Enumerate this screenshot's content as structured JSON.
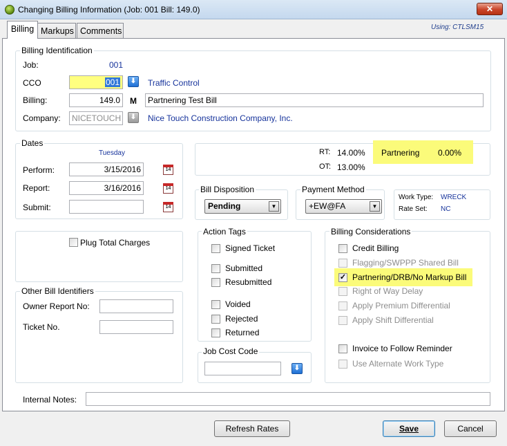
{
  "window": {
    "title": "Changing Billing Information  (Job: 001  Bill: 149.0)",
    "close": "✕"
  },
  "tabs": [
    "Billing",
    "Markups",
    "Comments"
  ],
  "using": "Using:  CTLSM15",
  "billing_id": {
    "legend": "Billing Identification",
    "job_label": "Job:",
    "job_value": "001",
    "cco_label": "CCO",
    "cco_value": "001",
    "cco_desc": "Traffic Control",
    "billing_label": "Billing:",
    "billing_value": "149.0",
    "billing_flag": "M",
    "billing_desc": "Partnering Test Bill",
    "company_label": "Company:",
    "company_value": "NICETOUCH",
    "company_desc": "Nice Touch Construction Company, Inc."
  },
  "dates": {
    "legend": "Dates",
    "weekday": "Tuesday",
    "perform_label": "Perform:",
    "perform_value": "3/15/2016",
    "report_label": "Report:",
    "report_value": "3/16/2016",
    "submit_label": "Submit:",
    "submit_value": "",
    "cal_text": "14"
  },
  "rates": {
    "rt_label": "RT:",
    "rt_value": "14.00%",
    "ot_label": "OT:",
    "ot_value": "13.00%",
    "partnering_label": "Partnering",
    "partnering_value": "0.00%"
  },
  "bill_disposition": {
    "legend": "Bill Disposition",
    "value": "Pending"
  },
  "payment_method": {
    "legend": "Payment Method",
    "value": "+EW@FA"
  },
  "work": {
    "type_label": "Work Type:",
    "type_value": "WRECK",
    "rate_label": "Rate Set:",
    "rate_value": "NC"
  },
  "plug_total": {
    "label": "Plug Total Charges",
    "checked": false
  },
  "other_ids": {
    "legend": "Other Bill Identifiers",
    "owner_label": "Owner Report No:",
    "owner_value": "",
    "ticket_label": "Ticket No.",
    "ticket_value": ""
  },
  "action_tags": {
    "legend": "Action Tags",
    "items": [
      "Signed Ticket",
      "Submitted",
      "Resubmitted",
      "Voided",
      "Rejected",
      "Returned"
    ]
  },
  "job_cost_code": {
    "legend": "Job Cost Code",
    "value": ""
  },
  "billing_considerations": {
    "legend": "Billing Considerations",
    "items": [
      {
        "label": "Credit Billing",
        "checked": false,
        "enabled": true
      },
      {
        "label": "Flagging/SWPPP Shared Bill",
        "checked": false,
        "enabled": false
      },
      {
        "label": "Partnering/DRB/No Markup Bill",
        "checked": true,
        "enabled": true
      },
      {
        "label": "Right of Way Delay",
        "checked": false,
        "enabled": false
      },
      {
        "label": "Apply Premium Differential",
        "checked": false,
        "enabled": false
      },
      {
        "label": "Apply Shift Differential",
        "checked": false,
        "enabled": false
      },
      {
        "label": "Invoice to Follow Reminder",
        "checked": false,
        "enabled": true
      },
      {
        "label": "Use Alternate Work Type",
        "checked": false,
        "enabled": false
      }
    ]
  },
  "internal_notes": {
    "label": "Internal Notes:",
    "value": ""
  },
  "buttons": {
    "refresh": "Refresh Rates",
    "save": "Save",
    "cancel": "Cancel"
  },
  "icons": {
    "check": "✓",
    "dropdown": "▼",
    "down_arrow": "⬇"
  }
}
